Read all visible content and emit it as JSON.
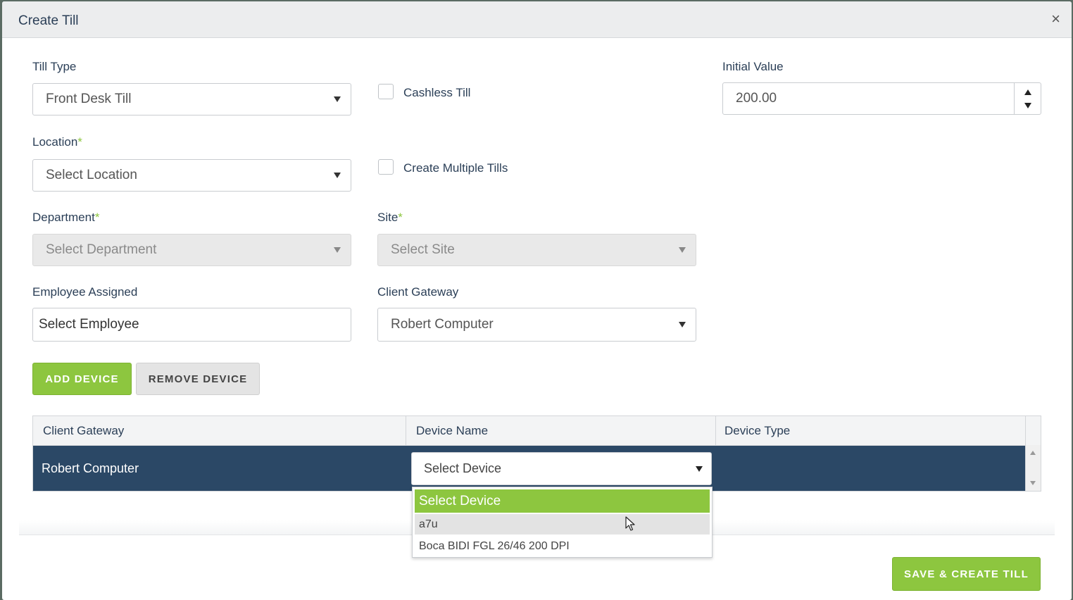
{
  "modal": {
    "title": "Create Till",
    "close_symbol": "×"
  },
  "form": {
    "till_type": {
      "label": "Till Type",
      "value": "Front Desk Till"
    },
    "cashless_till": {
      "label": "Cashless Till",
      "checked": false
    },
    "initial_value": {
      "label": "Initial Value",
      "value": "200.00"
    },
    "location": {
      "label": "Location",
      "required_mark": "*",
      "value": "Select Location"
    },
    "create_multiple_tills": {
      "label": "Create Multiple Tills",
      "checked": false
    },
    "department": {
      "label": "Department",
      "required_mark": "*",
      "value": "Select Department"
    },
    "site": {
      "label": "Site",
      "required_mark": "*",
      "value": "Select Site"
    },
    "employee_assigned": {
      "label": "Employee Assigned",
      "value": "Select Employee"
    },
    "client_gateway": {
      "label": "Client Gateway",
      "value": "Robert Computer"
    }
  },
  "buttons": {
    "add_device": "ADD DEVICE",
    "remove_device": "REMOVE DEVICE",
    "save_create": "SAVE & CREATE TILL"
  },
  "device_grid": {
    "columns": [
      "Client Gateway",
      "Device Name",
      "Device Type"
    ],
    "rows": [
      {
        "client_gateway": "Robert Computer",
        "device_name": "Select Device",
        "device_type": ""
      }
    ]
  },
  "device_dropdown": {
    "options": [
      "Select Device",
      "a7u",
      "Boca BIDI FGL 26/46 200 DPI"
    ],
    "selected": "Select Device",
    "hovered": "a7u"
  },
  "colors": {
    "accent_green": "#8dc63f",
    "row_selected": "#2b4866",
    "label_text": "#2b3f57"
  }
}
